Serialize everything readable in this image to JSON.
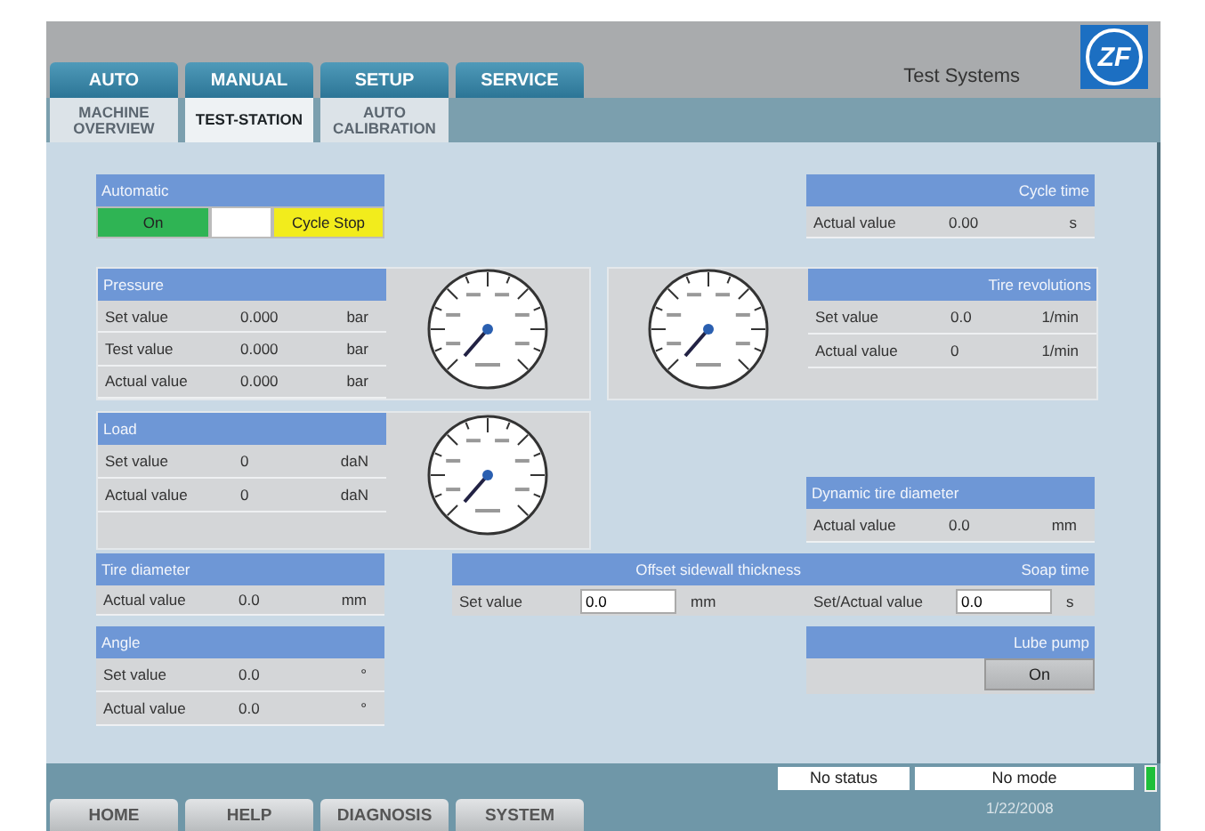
{
  "header": {
    "title": "Test Systems",
    "logo": "ZF"
  },
  "top_tabs": [
    {
      "label": "AUTO",
      "selected": false
    },
    {
      "label": "MANUAL",
      "selected": false
    },
    {
      "label": "SETUP",
      "selected": false
    },
    {
      "label": "SERVICE",
      "selected": false
    }
  ],
  "sub_tabs": [
    {
      "label": "MACHINE OVERVIEW",
      "selected": false
    },
    {
      "label": "TEST-STATION",
      "selected": true
    },
    {
      "label": "AUTO CALIBRATION",
      "selected": false
    }
  ],
  "panels": [
    {
      "title": "Automatic",
      "rows": [
        {
          "kind": "indicators",
          "items": [
            {
              "label": "On",
              "color": "#2fb454"
            },
            {
              "color": "#ffffff"
            },
            {
              "label": "Cycle Stop",
              "color": "#f2ec1c"
            }
          ]
        }
      ]
    },
    {
      "title": "Cycle time",
      "rows": [
        {
          "kind": "reading",
          "label": "Actual value",
          "value": "0.00",
          "unit": "s"
        }
      ]
    },
    {
      "title": "Pressure",
      "rows": [
        {
          "kind": "reading",
          "label": "Set value",
          "value": "0.000",
          "unit": "bar"
        },
        {
          "kind": "reading",
          "label": "Test value",
          "value": "0.000",
          "unit": "bar"
        },
        {
          "kind": "reading",
          "label": "Actual value",
          "value": "0.000",
          "unit": "bar"
        }
      ]
    },
    {
      "title": "Tire revolutions",
      "rows": [
        {
          "kind": "reading",
          "label": "Set value",
          "value": "0.0",
          "unit": "1/min"
        },
        {
          "kind": "reading",
          "label": "Actual value",
          "value": "0",
          "unit": "1/min"
        }
      ]
    },
    {
      "title": "Load",
      "rows": [
        {
          "kind": "reading",
          "label": "Set value",
          "value": "0",
          "unit": "daN"
        },
        {
          "kind": "reading",
          "label": "Actual value",
          "value": "0",
          "unit": "daN"
        }
      ]
    },
    {
      "title": "Dynamic tire diameter",
      "rows": [
        {
          "kind": "reading",
          "label": "Actual value",
          "value": "0.0",
          "unit": "mm"
        }
      ]
    },
    {
      "title": "Tire diameter",
      "rows": [
        {
          "kind": "reading",
          "label": "Actual value",
          "value": "0.0",
          "unit": "mm"
        }
      ]
    },
    {
      "title": "Offset sidewall thickness",
      "rows": [
        {
          "kind": "entry",
          "label": "Set value",
          "value": "0.0",
          "unit": "mm"
        }
      ]
    },
    {
      "title": "Soap time",
      "rows": [
        {
          "kind": "entry",
          "label": "Set/Actual value",
          "value": "0.0",
          "unit": "s"
        }
      ]
    },
    {
      "title": "Angle",
      "rows": [
        {
          "kind": "reading",
          "label": "Set value",
          "value": "0.0",
          "unit": "°"
        },
        {
          "kind": "reading",
          "label": "Actual value",
          "value": "0.0",
          "unit": "°"
        }
      ]
    },
    {
      "title": "Lube pump",
      "rows": [
        {
          "kind": "switch",
          "label": "On"
        }
      ]
    }
  ],
  "status_bar": {
    "status": "No status",
    "mode": "No mode",
    "date": "1/22/2008"
  },
  "nav_buttons": [
    "HOME",
    "HELP",
    "DIAGNOSIS",
    "SYSTEM"
  ]
}
